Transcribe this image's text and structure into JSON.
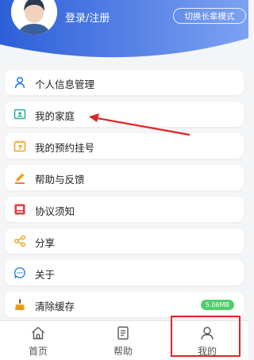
{
  "header": {
    "login_label": "登录/注册",
    "switch_label": "切换长辈模式",
    "colors": {
      "gradient_start": "#2d5fd8",
      "gradient_end": "#7ca2f2"
    }
  },
  "menu": {
    "items": [
      {
        "label": "个人信息管理",
        "icon": "person-icon"
      },
      {
        "label": "我的家庭",
        "icon": "family-card-icon"
      },
      {
        "label": "我的预约挂号",
        "icon": "appointment-calendar-icon"
      },
      {
        "label": "帮助与反馈",
        "icon": "pencil-icon"
      },
      {
        "label": "协议须知",
        "icon": "agreement-icon"
      },
      {
        "label": "分享",
        "icon": "share-icon"
      },
      {
        "label": "关于",
        "icon": "about-chat-icon"
      },
      {
        "label": "清除缓存",
        "icon": "broom-icon",
        "badge": "5.06MB"
      }
    ]
  },
  "tabbar": {
    "tabs": [
      {
        "label": "首页",
        "icon": "home-icon"
      },
      {
        "label": "帮助",
        "icon": "help-doc-icon"
      },
      {
        "label": "我的",
        "icon": "user-icon",
        "highlighted": true
      }
    ]
  },
  "annotation": {
    "highlight_color": "#e02424"
  }
}
